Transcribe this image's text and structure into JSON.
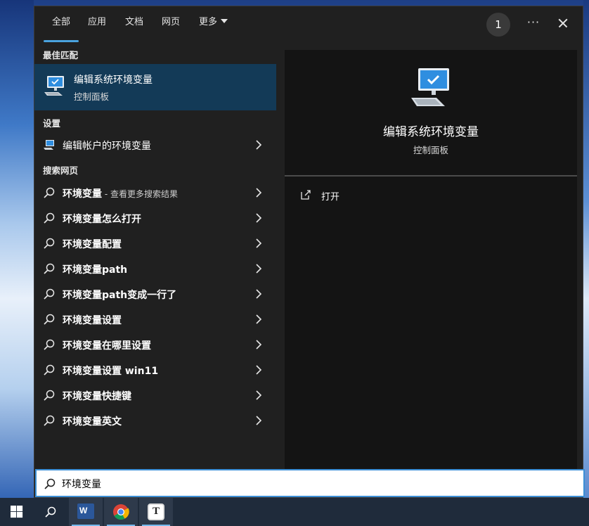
{
  "tabs": [
    {
      "label": "全部",
      "active": true
    },
    {
      "label": "应用",
      "active": false
    },
    {
      "label": "文档",
      "active": false
    },
    {
      "label": "网页",
      "active": false
    },
    {
      "label": "更多",
      "active": false
    }
  ],
  "header": {
    "badge_count": "1",
    "more_label": "···"
  },
  "sections": {
    "best_match": "最佳匹配",
    "settings": "设置",
    "web": "搜索网页"
  },
  "best_match": {
    "title": "编辑系统环境变量",
    "subtitle": "控制面板",
    "icon": "monitor-check-icon"
  },
  "settings_items": [
    {
      "label": "编辑帐户的环境变量",
      "icon": "monitor-settings-icon"
    }
  ],
  "web_items": [
    {
      "label": "环境变量",
      "hint": " - 查看更多搜索结果"
    },
    {
      "label": "环境变量怎么打开",
      "hint": ""
    },
    {
      "label": "环境变量配置",
      "hint": ""
    },
    {
      "label": "环境变量path",
      "hint": ""
    },
    {
      "label": "环境变量path变成一行了",
      "hint": ""
    },
    {
      "label": "环境变量设置",
      "hint": ""
    },
    {
      "label": "环境变量在哪里设置",
      "hint": ""
    },
    {
      "label": "环境变量设置 win11",
      "hint": ""
    },
    {
      "label": "环境变量快捷键",
      "hint": ""
    },
    {
      "label": "环境变量英文",
      "hint": ""
    }
  ],
  "preview": {
    "title": "编辑系统环境变量",
    "subtitle": "控制面板",
    "actions": [
      {
        "label": "打开",
        "icon": "open-external-icon"
      }
    ]
  },
  "search": {
    "value": "环境变量",
    "placeholder": ""
  },
  "taskbar": {
    "items": [
      {
        "name": "windows-start-icon"
      },
      {
        "name": "search-icon"
      },
      {
        "name": "word-icon",
        "letter": "W"
      },
      {
        "name": "chrome-icon"
      },
      {
        "name": "typora-icon",
        "letter": "T"
      }
    ]
  },
  "colors": {
    "accent": "#4aa3df",
    "selection": "#133a57",
    "panel": "#202020",
    "preview": "#141414"
  }
}
